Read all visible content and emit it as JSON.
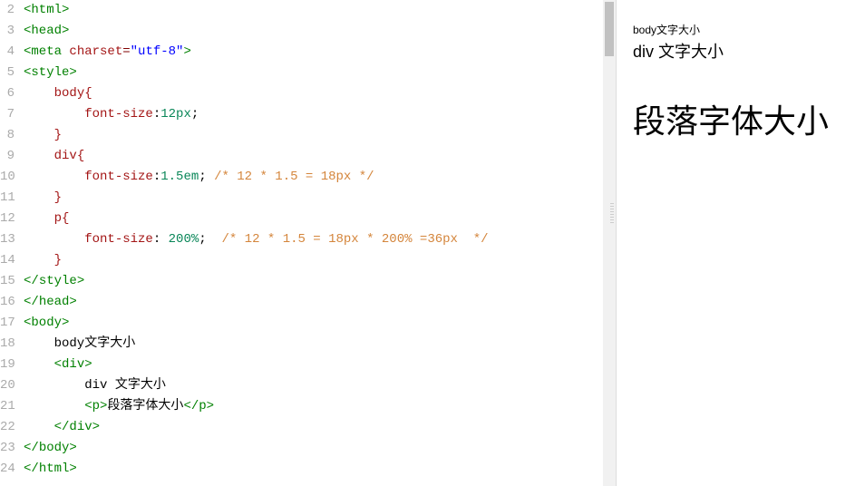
{
  "editor": {
    "first_line_number": 2,
    "lines": [
      {
        "tokens": [
          [
            "angle",
            "<"
          ],
          [
            "tag",
            "html"
          ],
          [
            "angle",
            ">"
          ]
        ]
      },
      {
        "tokens": [
          [
            "angle",
            "<"
          ],
          [
            "tag",
            "head"
          ],
          [
            "angle",
            ">"
          ]
        ]
      },
      {
        "tokens": [
          [
            "angle",
            "<"
          ],
          [
            "tag",
            "meta"
          ],
          [
            "text",
            " "
          ],
          [
            "attr",
            "charset"
          ],
          [
            "punct",
            "="
          ],
          [
            "str",
            "\"utf-8\""
          ],
          [
            "angle",
            ">"
          ]
        ]
      },
      {
        "tokens": [
          [
            "angle",
            "<"
          ],
          [
            "tag",
            "style"
          ],
          [
            "angle",
            ">"
          ]
        ]
      },
      {
        "tokens": [
          [
            "text",
            "    "
          ],
          [
            "sel",
            "body"
          ],
          [
            "brace",
            "{"
          ]
        ]
      },
      {
        "tokens": [
          [
            "text",
            "        "
          ],
          [
            "prop",
            "font-size"
          ],
          [
            "text",
            ":"
          ],
          [
            "num",
            "12px"
          ],
          [
            "text",
            ";"
          ]
        ]
      },
      {
        "tokens": [
          [
            "text",
            "    "
          ],
          [
            "brace",
            "}"
          ]
        ]
      },
      {
        "tokens": [
          [
            "text",
            "    "
          ],
          [
            "sel",
            "div"
          ],
          [
            "brace",
            "{"
          ]
        ]
      },
      {
        "tokens": [
          [
            "text",
            "        "
          ],
          [
            "prop",
            "font-size"
          ],
          [
            "text",
            ":"
          ],
          [
            "num",
            "1.5em"
          ],
          [
            "text",
            "; "
          ],
          [
            "comm",
            "/* 12 * 1.5 = 18px */"
          ]
        ]
      },
      {
        "tokens": [
          [
            "text",
            "    "
          ],
          [
            "brace",
            "}"
          ]
        ]
      },
      {
        "tokens": [
          [
            "text",
            "    "
          ],
          [
            "sel",
            "p"
          ],
          [
            "brace",
            "{"
          ]
        ]
      },
      {
        "tokens": [
          [
            "text",
            "        "
          ],
          [
            "prop",
            "font-size"
          ],
          [
            "text",
            ": "
          ],
          [
            "num",
            "200%"
          ],
          [
            "text",
            "; "
          ],
          [
            "comm",
            " /* 12 * 1.5 = 18px * 200% =36px  */"
          ]
        ]
      },
      {
        "tokens": [
          [
            "text",
            "    "
          ],
          [
            "brace",
            "}"
          ]
        ]
      },
      {
        "tokens": [
          [
            "angle",
            "</"
          ],
          [
            "tag",
            "style"
          ],
          [
            "angle",
            ">"
          ]
        ]
      },
      {
        "tokens": [
          [
            "angle",
            "</"
          ],
          [
            "tag",
            "head"
          ],
          [
            "angle",
            ">"
          ]
        ]
      },
      {
        "tokens": [
          [
            "angle",
            "<"
          ],
          [
            "tag",
            "body"
          ],
          [
            "angle",
            ">"
          ]
        ]
      },
      {
        "tokens": [
          [
            "text",
            "    body文字大小"
          ]
        ]
      },
      {
        "tokens": [
          [
            "text",
            "    "
          ],
          [
            "angle",
            "<"
          ],
          [
            "tag",
            "div"
          ],
          [
            "angle",
            ">"
          ]
        ]
      },
      {
        "tokens": [
          [
            "text",
            "        div 文字大小"
          ]
        ]
      },
      {
        "tokens": [
          [
            "text",
            "        "
          ],
          [
            "angle",
            "<"
          ],
          [
            "tag",
            "p"
          ],
          [
            "angle",
            ">"
          ],
          [
            "text",
            "段落字体大小"
          ],
          [
            "angle",
            "</"
          ],
          [
            "tag",
            "p"
          ],
          [
            "angle",
            ">"
          ]
        ]
      },
      {
        "tokens": [
          [
            "text",
            "    "
          ],
          [
            "angle",
            "</"
          ],
          [
            "tag",
            "div"
          ],
          [
            "angle",
            ">"
          ]
        ]
      },
      {
        "tokens": [
          [
            "angle",
            "</"
          ],
          [
            "tag",
            "body"
          ],
          [
            "angle",
            ">"
          ]
        ]
      },
      {
        "tokens": [
          [
            "angle",
            "</"
          ],
          [
            "tag",
            "html"
          ],
          [
            "angle",
            ">"
          ]
        ]
      }
    ]
  },
  "preview": {
    "body_text": "body文字大小",
    "div_text": "div 文字大小",
    "p_text": "段落字体大小"
  }
}
